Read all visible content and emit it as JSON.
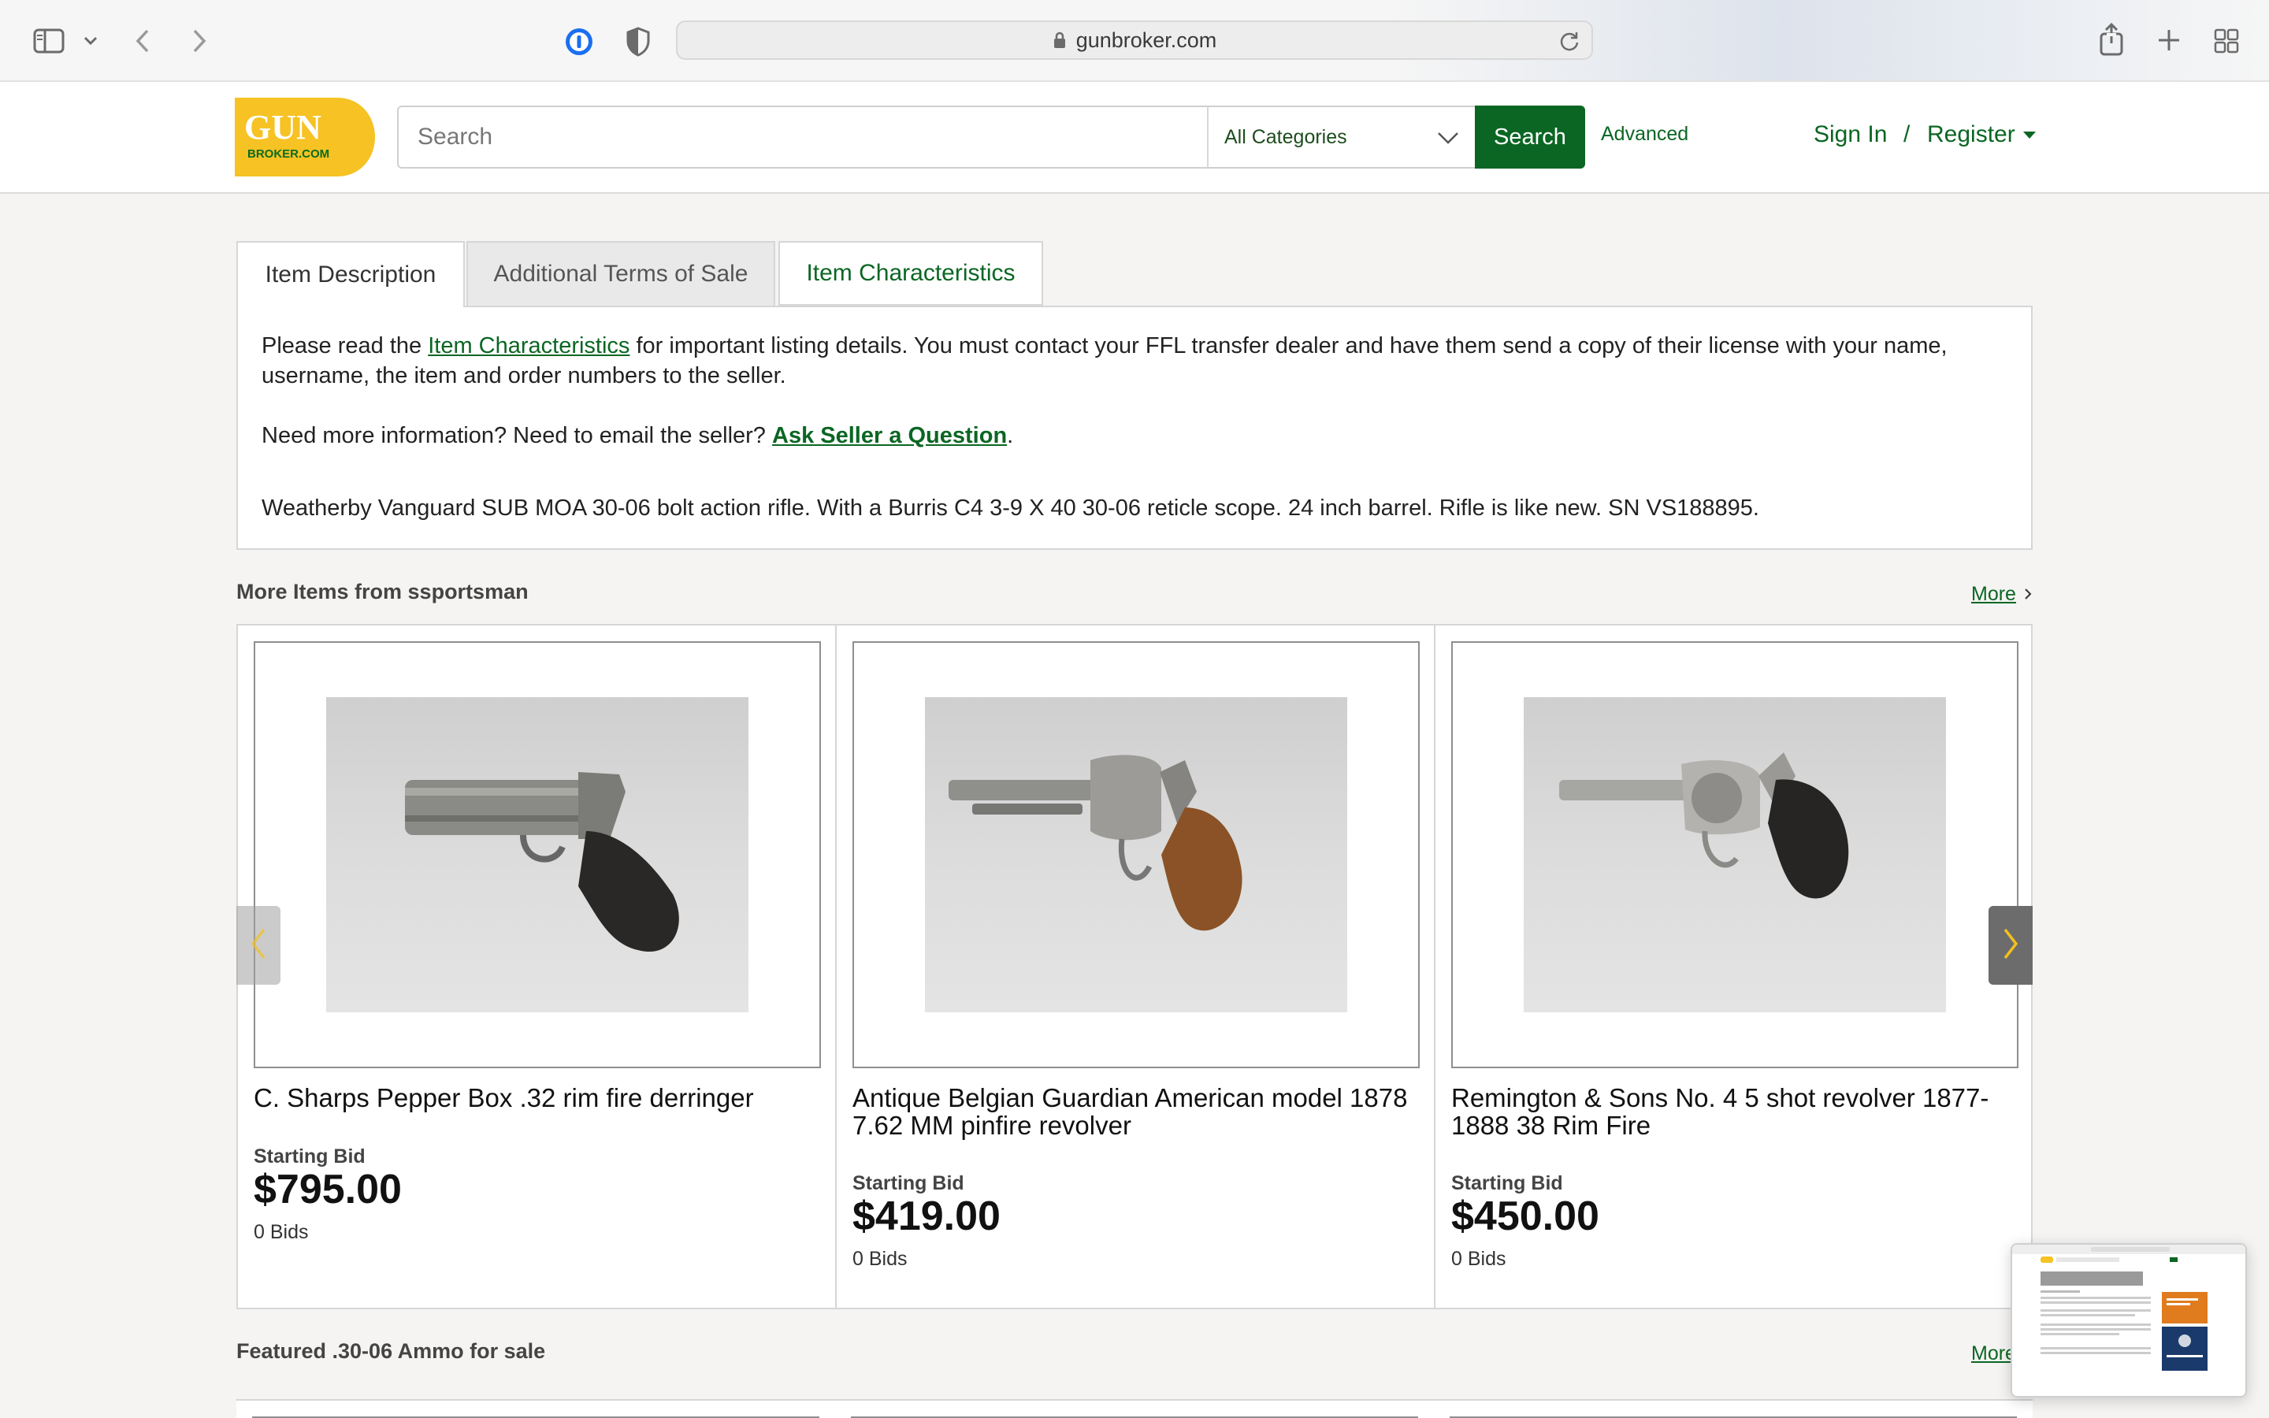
{
  "browser": {
    "url": "gunbroker.com"
  },
  "header": {
    "logo_line1": "GUN",
    "logo_line2": "BROKER.COM",
    "search_placeholder": "Search",
    "category_selected": "All Categories",
    "search_button": "Search",
    "advanced_link": "Advanced",
    "sign_in": "Sign In",
    "separator": "/",
    "register": "Register"
  },
  "tabs": [
    {
      "label": "Item Description",
      "active": true
    },
    {
      "label": "Additional Terms of Sale",
      "active": false
    },
    {
      "label": "Item Characteristics",
      "active": false
    }
  ],
  "description": {
    "p1_before": "Please read the ",
    "p1_link": "Item Characteristics",
    "p1_after": " for important listing details. You must contact your FFL transfer dealer and have them send a copy of their license with your name, username, the item and order numbers to the seller.",
    "p2_before": "Need more information? Need to email the seller? ",
    "p2_link": "Ask Seller a Question",
    "p2_after": ".",
    "item_text": "Weatherby Vanguard SUB MOA 30-06 bolt action rifle. With a Burris C4 3-9 X 40 30-06 reticle scope. 24 inch barrel. Rifle is like new. SN VS188895."
  },
  "more_items": {
    "title": "More Items from ssportsman",
    "more_link": "More",
    "items": [
      {
        "title": "C. Sharps Pepper Box .32 rim fire derringer",
        "bid_label": "Starting Bid",
        "price": "$795.00",
        "bids": "0 Bids"
      },
      {
        "title": "Antique Belgian Guardian American model 1878 7.62 MM pinfire revolver",
        "bid_label": "Starting Bid",
        "price": "$419.00",
        "bids": "0 Bids"
      },
      {
        "title": "Remington & Sons No. 4 5 shot revolver 1877-1888 38 Rim Fire",
        "bid_label": "Starting Bid",
        "price": "$450.00",
        "bids": "0 Bids"
      }
    ]
  },
  "featured": {
    "title": "Featured .30-06 Ammo for sale",
    "more_link": "More"
  },
  "colors": {
    "brand_green": "#0b6623",
    "logo_yellow": "#f6c224"
  }
}
